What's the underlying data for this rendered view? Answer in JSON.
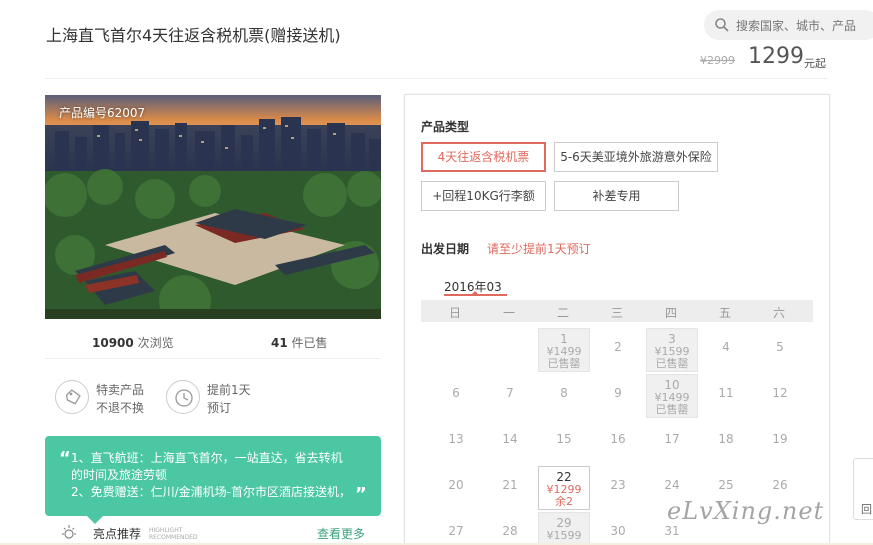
{
  "page": {
    "title": "上海直飞首尔4天往返含税机票(赠接送机)",
    "search_placeholder": "搜索国家、城市、产品",
    "price_old": "¥2999",
    "price_new": "1299",
    "price_unit": "元起"
  },
  "product": {
    "number": "产品编号62007",
    "views_count": "10900",
    "views_label": "次浏览",
    "sold_count": "41",
    "sold_label": "件已售"
  },
  "features": [
    {
      "icon": "tag-icon",
      "line1": "特卖产品",
      "line2": "不退不换"
    },
    {
      "icon": "clock-icon",
      "line1": "提前1天",
      "line2": "预订"
    }
  ],
  "highlights": {
    "line1": "1、直飞航班：上海直飞首尔，一站直达，省去转机",
    "line2": "的时间及旅途劳顿",
    "line3": "2、免费赠送：仁川/金浦机场-首尔市区酒店接送机，",
    "title": "亮点推荐",
    "en1": "HIGHLIGHT",
    "en2": "RECOMMENDED",
    "more": "查看更多"
  },
  "booking": {
    "type_label": "产品类型",
    "types": [
      "4天往返含税机票",
      "5-6天美亚境外旅游意外保险",
      "+回程10KG行李额",
      "补差专用"
    ],
    "selected_type": 0,
    "date_label": "出发日期",
    "date_hint": "请至少提前1天预订",
    "month": "2016年03",
    "weekdays": [
      "日",
      "一",
      "二",
      "三",
      "四",
      "五",
      "六"
    ]
  },
  "calendar": [
    {
      "n": "1",
      "col": 2,
      "row": 0,
      "price": "¥1499",
      "status": "已售罄",
      "state": "sold"
    },
    {
      "n": "2",
      "col": 3,
      "row": 0,
      "state": "plain"
    },
    {
      "n": "3",
      "col": 4,
      "row": 0,
      "price": "¥1599",
      "status": "已售罄",
      "state": "sold"
    },
    {
      "n": "4",
      "col": 5,
      "row": 0,
      "state": "plain"
    },
    {
      "n": "5",
      "col": 6,
      "row": 0,
      "state": "plain"
    },
    {
      "n": "6",
      "col": 0,
      "row": 1,
      "state": "plain"
    },
    {
      "n": "7",
      "col": 1,
      "row": 1,
      "state": "plain"
    },
    {
      "n": "8",
      "col": 2,
      "row": 1,
      "state": "plain"
    },
    {
      "n": "9",
      "col": 3,
      "row": 1,
      "state": "plain"
    },
    {
      "n": "10",
      "col": 4,
      "row": 1,
      "price": "¥1499",
      "status": "已售罄",
      "state": "sold"
    },
    {
      "n": "11",
      "col": 5,
      "row": 1,
      "state": "plain"
    },
    {
      "n": "12",
      "col": 6,
      "row": 1,
      "state": "plain"
    },
    {
      "n": "13",
      "col": 0,
      "row": 2,
      "state": "plain"
    },
    {
      "n": "14",
      "col": 1,
      "row": 2,
      "state": "plain"
    },
    {
      "n": "15",
      "col": 2,
      "row": 2,
      "state": "plain"
    },
    {
      "n": "16",
      "col": 3,
      "row": 2,
      "state": "plain"
    },
    {
      "n": "17",
      "col": 4,
      "row": 2,
      "state": "plain"
    },
    {
      "n": "18",
      "col": 5,
      "row": 2,
      "state": "plain"
    },
    {
      "n": "19",
      "col": 6,
      "row": 2,
      "state": "plain"
    },
    {
      "n": "20",
      "col": 0,
      "row": 3,
      "state": "plain"
    },
    {
      "n": "21",
      "col": 1,
      "row": 3,
      "state": "plain"
    },
    {
      "n": "22",
      "col": 2,
      "row": 3,
      "price": "¥1299",
      "status": "余2",
      "state": "avail"
    },
    {
      "n": "23",
      "col": 3,
      "row": 3,
      "state": "plain"
    },
    {
      "n": "24",
      "col": 4,
      "row": 3,
      "state": "plain"
    },
    {
      "n": "25",
      "col": 5,
      "row": 3,
      "state": "plain"
    },
    {
      "n": "26",
      "col": 6,
      "row": 3,
      "state": "plain"
    },
    {
      "n": "27",
      "col": 0,
      "row": 4,
      "state": "plain"
    },
    {
      "n": "28",
      "col": 1,
      "row": 4,
      "state": "plain"
    },
    {
      "n": "29",
      "col": 2,
      "row": 4,
      "price": "¥1599",
      "status": "",
      "state": "sold"
    },
    {
      "n": "30",
      "col": 3,
      "row": 4,
      "state": "plain"
    },
    {
      "n": "31",
      "col": 4,
      "row": 4,
      "state": "plain"
    }
  ],
  "watermark": "eLvXing.net",
  "side_button": "回",
  "colors": {
    "accent": "#e06a5e",
    "highlight_bg": "#4bc7a3",
    "more_link": "#3ea07f"
  }
}
